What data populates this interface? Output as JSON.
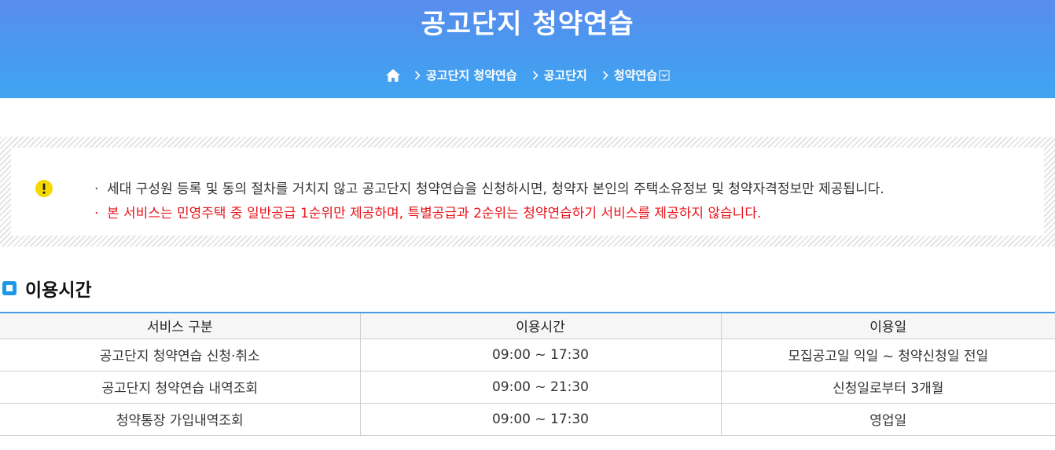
{
  "header": {
    "title": "공고단지 청약연습",
    "breadcrumb": [
      "공고단지 청약연습",
      "공고단지",
      "청약연습"
    ]
  },
  "notice": {
    "lines": [
      "세대 구성원 등록 및 동의 절차를 거치지 않고 공고단지 청약연습을 신청하시면, 청약자 본인의 주택소유정보 및 청약자격정보만 제공됩니다.",
      "본 서비스는 민영주택 중 일반공급 1순위만 제공하며, 특별공급과 2순위는 청약연습하기 서비스를 제공하지 않습니다."
    ],
    "bullet": "·"
  },
  "section": {
    "title": "이용시간"
  },
  "table": {
    "headers": [
      "서비스 구분",
      "이용시간",
      "이용일"
    ],
    "rows": [
      [
        "공고단지 청약연습 신청·취소",
        "09:00 ~ 17:30",
        "모집공고일 익일 ~ 청약신청일 전일"
      ],
      [
        "공고단지 청약연습 내역조회",
        "09:00 ~ 21:30",
        "신청일로부터 3개월"
      ],
      [
        "청약통장 가입내역조회",
        "09:00 ~ 17:30",
        "영업일"
      ]
    ]
  },
  "colors": {
    "banner_top": "#5b8def",
    "banner_bottom": "#3fa5f3",
    "warning": "#e8141b",
    "accent": "#1c98e6",
    "notice_icon": "#f5d800"
  },
  "icons": {
    "home": "home-icon",
    "separator": "chevron-right-icon",
    "dropdown": "dropdown-icon",
    "notice": "exclamation-icon",
    "section": "square-bullet-icon"
  }
}
